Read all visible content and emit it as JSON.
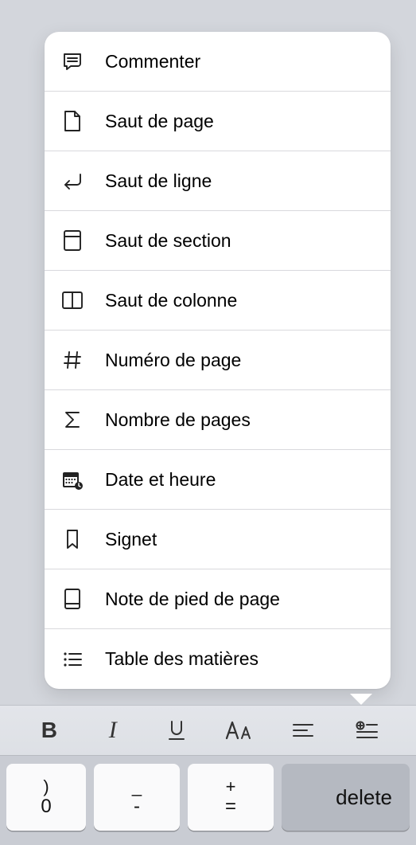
{
  "menu": {
    "items": [
      {
        "label": "Commenter",
        "icon": "comment-icon"
      },
      {
        "label": "Saut de page",
        "icon": "page-break-icon"
      },
      {
        "label": "Saut de ligne",
        "icon": "line-break-icon"
      },
      {
        "label": "Saut de section",
        "icon": "section-break-icon"
      },
      {
        "label": "Saut de colonne",
        "icon": "column-break-icon"
      },
      {
        "label": "Numéro de page",
        "icon": "hash-icon"
      },
      {
        "label": "Nombre de pages",
        "icon": "sigma-icon"
      },
      {
        "label": "Date et heure",
        "icon": "calendar-icon"
      },
      {
        "label": "Signet",
        "icon": "bookmark-icon"
      },
      {
        "label": "Note de pied de page",
        "icon": "footnote-icon"
      },
      {
        "label": "Table des matières",
        "icon": "list-icon"
      }
    ]
  },
  "toolbar": {
    "bold": "B",
    "italic": "I",
    "underline": "U",
    "font": "AA"
  },
  "keyboard": {
    "k0_top": ")",
    "k0_bottom": "0",
    "k1_top": "_",
    "k1_bottom": "-",
    "k2_top": "+",
    "k2_bottom": "=",
    "delete": "delete"
  }
}
